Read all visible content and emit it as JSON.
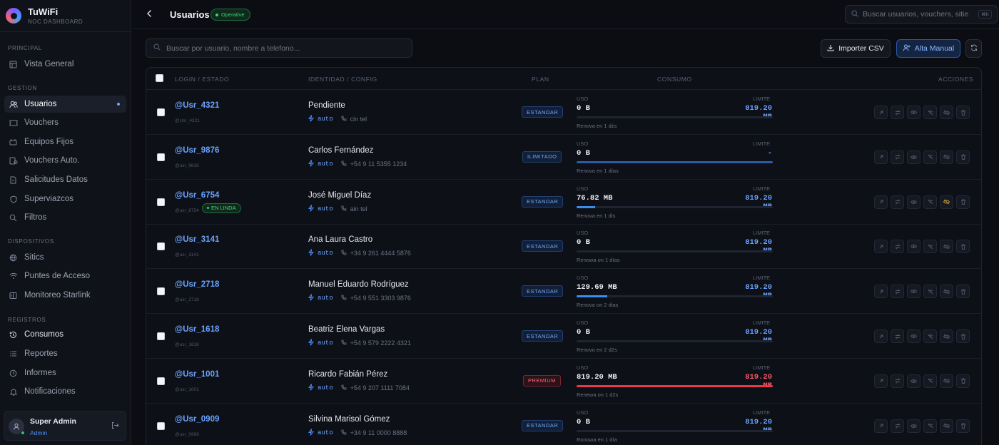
{
  "brand": {
    "name": "TuWiFi",
    "subtitle": "NOC DASHBOARD"
  },
  "sidebar": {
    "sections": [
      {
        "label": "PRINCIPAL"
      },
      {
        "label": "GESTION"
      },
      {
        "label": "DISPOSITIVOS"
      },
      {
        "label": "REGISTROS"
      }
    ],
    "items": [
      {
        "label": "Vista General",
        "icon": "dashboard-icon"
      },
      {
        "label": "Usuarios",
        "icon": "users-icon",
        "active": true
      },
      {
        "label": "Vouchers",
        "icon": "ticket-icon"
      },
      {
        "label": "Equipos Fijos",
        "icon": "router-icon"
      },
      {
        "label": "Vouchers Auto.",
        "icon": "auto-ticket-icon"
      },
      {
        "label": "Salicitudes Datos",
        "icon": "request-icon"
      },
      {
        "label": "Superviazcos",
        "icon": "shield-icon"
      },
      {
        "label": "Filtros",
        "icon": "filter-icon"
      },
      {
        "label": "Sitics",
        "icon": "globe-icon"
      },
      {
        "label": "Puntes de Acceso",
        "icon": "wifi-icon"
      },
      {
        "label": "Monitoreo Starlink",
        "icon": "satellite-icon"
      },
      {
        "label": "Consumos",
        "icon": "history-icon"
      },
      {
        "label": "Reportes",
        "icon": "list-icon"
      },
      {
        "label": "Informes",
        "icon": "clock-icon"
      },
      {
        "label": "Notificaciones",
        "icon": "bell-icon"
      }
    ],
    "user": {
      "name": "Super Admin",
      "role": "Admin"
    }
  },
  "topbar": {
    "title": "Usuarios",
    "status": "Operative",
    "search_placeholder": "Buscar usuarios, vouchers, sitie",
    "search_kbd": "⌘K"
  },
  "toolbar": {
    "search_placeholder": "Buscar por usuario, nombre a telefono...",
    "import_label": "Importer CSV",
    "alta_label": "Alta Manual"
  },
  "table": {
    "headers": {
      "login": "LOGIN / ESTADO",
      "identity": "IDENTIDAD / CONFIG",
      "plan": "PLAN",
      "consumo": "CONSUMO",
      "acciones": "ACCIONES"
    },
    "uso_label": "USO",
    "limite_label": "LIMITE",
    "rows": [
      {
        "login": "@Usr_4321",
        "sub": "@Usr_4321",
        "name": "Pendiente",
        "auto": "auto",
        "phone": "cin tel",
        "plan": "ESTANDAR",
        "uso": "0 B",
        "limite": "819.20 MB",
        "renew": "Renova en 1 dżs",
        "usage_pct": 0,
        "online": ""
      },
      {
        "login": "@Usr_9876",
        "sub": "@usr_9816",
        "name": "Carlos Fernández",
        "auto": "auto",
        "phone": "+54 9 11 5355 1234",
        "plan": "ILIMITADO",
        "uso": "0 B",
        "limite": "-",
        "renew": "Renova en 1 días",
        "usage_pct": 100,
        "online": ""
      },
      {
        "login": "@Usr_6754",
        "sub": "@usr_8754",
        "name": "José Miguel Díaz",
        "auto": "auto",
        "phone": "ain tel",
        "plan": "ESTANDAR",
        "uso": "76.82 MB",
        "limite": "819.20 MB",
        "renew": "Renova en 1 dis",
        "usage_pct": 9.4,
        "online": "EN LINDA"
      },
      {
        "login": "@Usr_3141",
        "sub": "@usr_3141",
        "name": "Ana Laura Castro",
        "auto": "auto",
        "phone": "+34 9 261 4444 5876",
        "plan": "ESTANDAR",
        "uso": "0 B",
        "limite": "819.20 MB",
        "renew": "Renowa on 1 días",
        "usage_pct": 0,
        "online": ""
      },
      {
        "login": "@Usr_2718",
        "sub": "@usr_2718",
        "name": "Manuel Eduardo Rodríguez",
        "auto": "auto",
        "phone": "+54 9 551 3303 9876",
        "plan": "ESTANDAR",
        "uso": "129.69 MB",
        "limite": "819.20 MB",
        "renew": "Renova on 2 dias",
        "usage_pct": 15.8,
        "online": ""
      },
      {
        "login": "@Usr_1618",
        "sub": "@usr_1618",
        "name": "Beatriz Elena Vargas",
        "auto": "auto",
        "phone": "+54 9 579 2222 4321",
        "plan": "ESTANDAR",
        "uso": "0 B",
        "limite": "819.20 MB",
        "renew": "Renovo en 2 d2s",
        "usage_pct": 0,
        "online": ""
      },
      {
        "login": "@Usr_1001",
        "sub": "@usr_1001",
        "name": "Ricardo Fabián Pérez",
        "auto": "auto",
        "phone": "+54 9 207 1111 7084",
        "plan": "PREMIUM",
        "uso": "819.20 MB",
        "limite": "819.20 MB",
        "renew": "Renewa on 1 d2s",
        "usage_pct": 100,
        "online": ""
      },
      {
        "login": "@Usr_0909",
        "sub": "@usr_0999",
        "name": "Silvina Marisol Gómez",
        "auto": "auto",
        "phone": "+34 9 11 0000 8888",
        "plan": "ESTANDAR",
        "uso": "0 B",
        "limite": "819.20 MB",
        "renew": "Ronowa en 1 día",
        "usage_pct": 0,
        "online": ""
      }
    ]
  }
}
